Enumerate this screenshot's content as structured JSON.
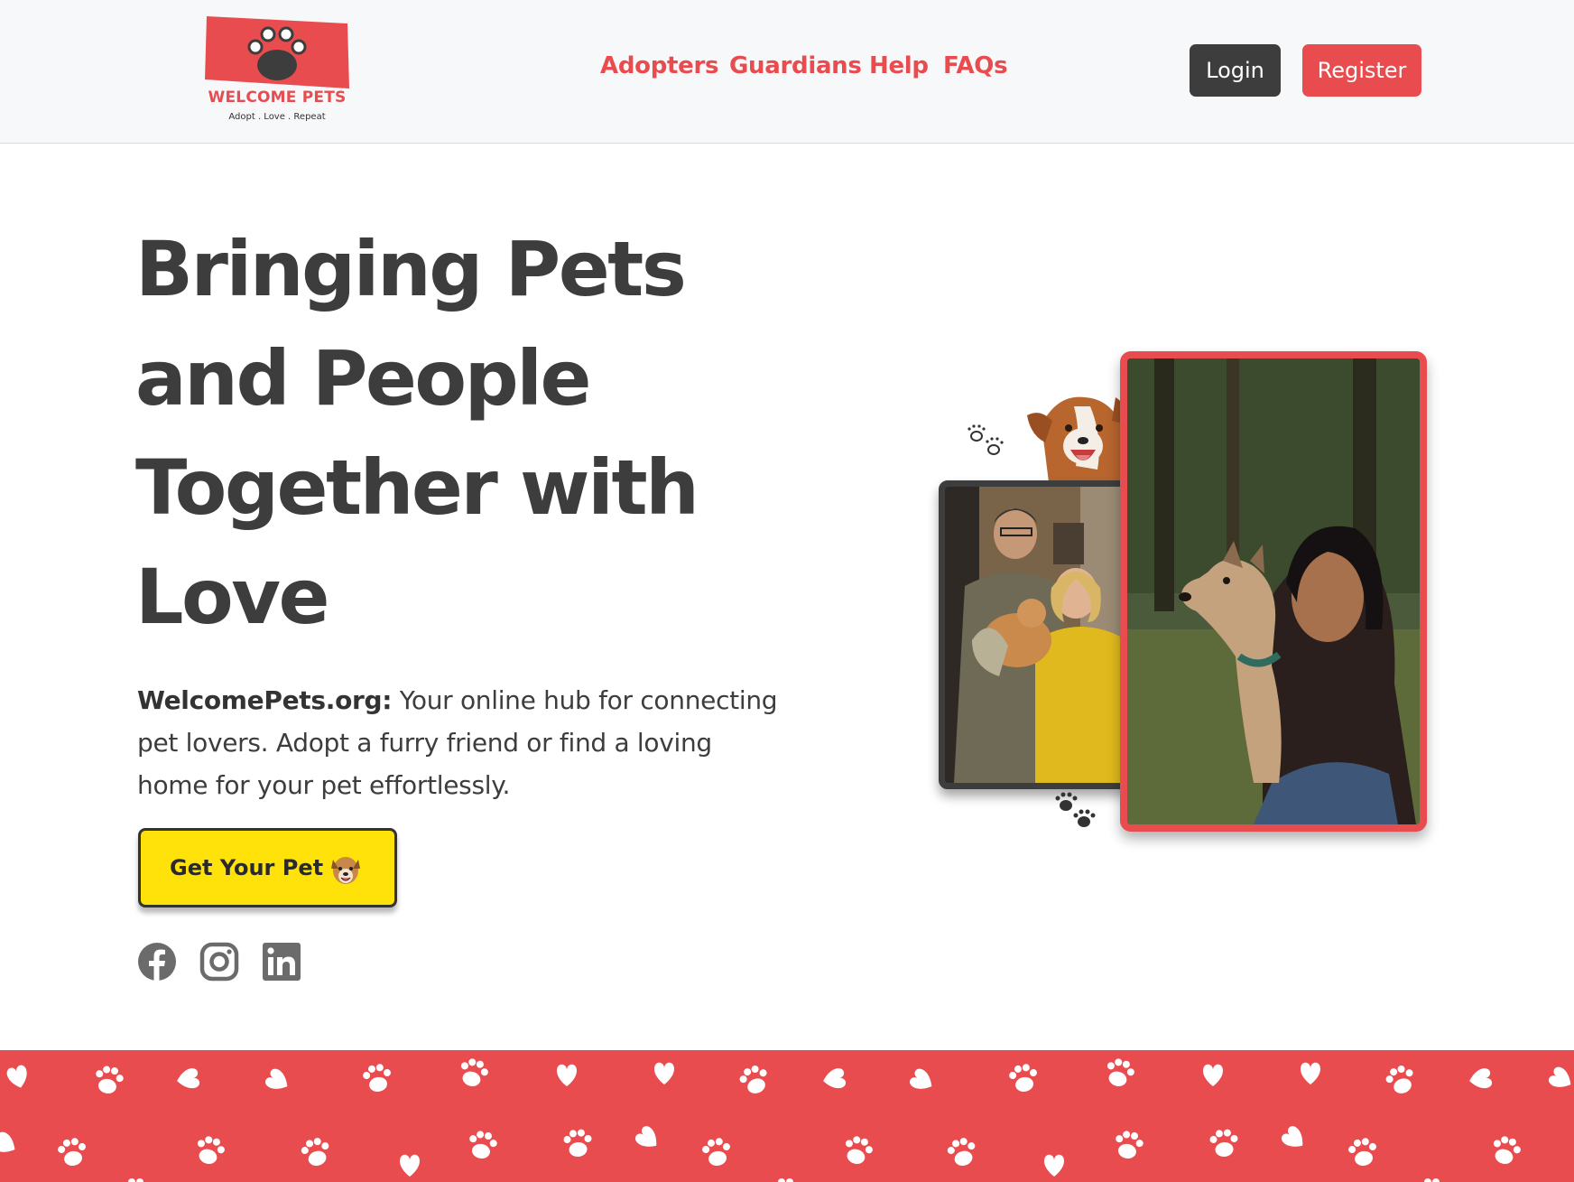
{
  "brand": {
    "name": "WELCOME PETS",
    "tagline": "Adopt . Love . Repeat",
    "logo_icon": "paw-icon"
  },
  "nav": {
    "links": [
      "Adopters",
      "Guardians",
      "Help",
      "FAQs"
    ],
    "login_label": "Login",
    "register_label": "Register"
  },
  "hero": {
    "title": "Bringing Pets and People Together with Love",
    "site_name": "WelcomePets.org:",
    "description": " Your online hub for connecting pet lovers. Adopt a furry friend or find a loving home for your pet effortlessly.",
    "cta_label": "Get Your Pet"
  },
  "social": {
    "icons": [
      "facebook-icon",
      "instagram-icon",
      "linkedin-icon"
    ]
  },
  "colors": {
    "brand_red": "#e84c4f",
    "dark": "#3d3d3d",
    "cta_yellow": "#ffe20a",
    "header_bg": "#f7f8f9"
  }
}
